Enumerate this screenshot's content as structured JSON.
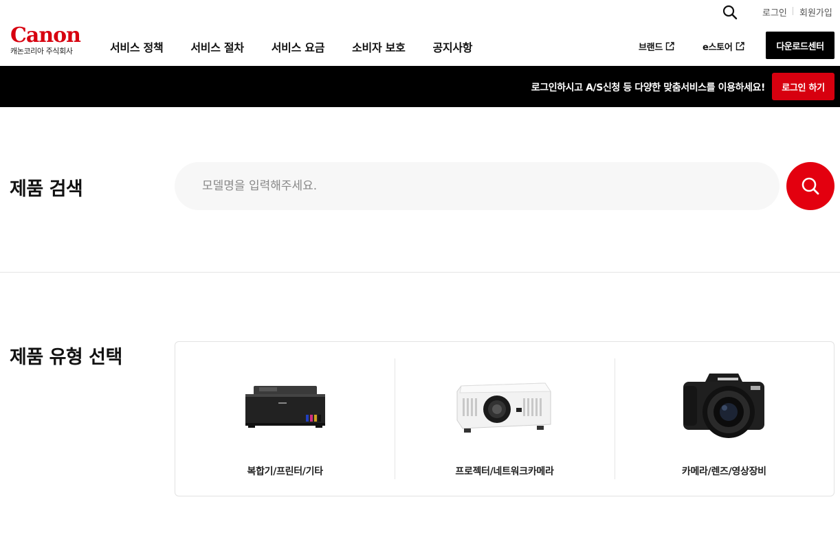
{
  "util": {
    "login": "로그인",
    "join": "회원가입"
  },
  "header": {
    "logo_wordmark": "Canon",
    "logo_sub": "캐논코리아 주식회사",
    "nav": [
      "서비스 정책",
      "서비스 절차",
      "서비스 요금",
      "소비자 보호",
      "공지사항"
    ],
    "brand_link": "브랜드",
    "estore_link": "e스토어",
    "download_center": "다운로드센터"
  },
  "banner": {
    "message": "로그인하시고 A/S신청 등 다양한 맞춤서비스를 이용하세요!",
    "login_button": "로그인 하기"
  },
  "search": {
    "title": "제품 검색",
    "placeholder": "모델명을 입력해주세요."
  },
  "product_types": {
    "title": "제품 유형 선택",
    "items": [
      {
        "label": "복합기/프린터/기타",
        "icon": "printer-image"
      },
      {
        "label": "프로젝터/네트워크카메라",
        "icon": "projector-image"
      },
      {
        "label": "카메라/렌즈/영상장비",
        "icon": "camera-image"
      }
    ]
  },
  "colors": {
    "brand_red": "#d7000f",
    "search_red": "#e3000f",
    "banner_black": "#000000"
  }
}
